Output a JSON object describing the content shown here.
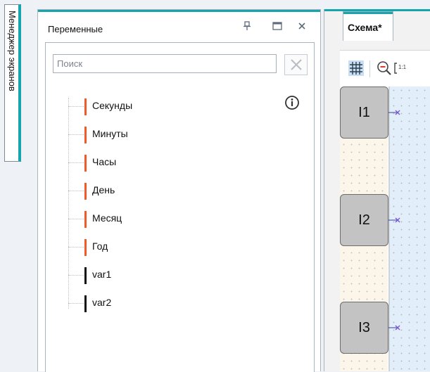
{
  "screen_manager": {
    "tab_label": "Менеджер экранов"
  },
  "variables_panel": {
    "title": "Переменные",
    "pin_icon": "pin-icon",
    "maximize_icon": "maximize-icon",
    "close_icon": "close-icon",
    "search": {
      "placeholder": "Поиск",
      "value": ""
    },
    "items": [
      {
        "label": "Секунды",
        "color": "#f05a28"
      },
      {
        "label": "Минуты",
        "color": "#f05a28"
      },
      {
        "label": "Часы",
        "color": "#f05a28"
      },
      {
        "label": "День",
        "color": "#f05a28"
      },
      {
        "label": "Месяц",
        "color": "#f05a28"
      },
      {
        "label": "Год",
        "color": "#f05a28"
      },
      {
        "label": "var1",
        "color": "#111111"
      },
      {
        "label": "var2",
        "color": "#111111"
      }
    ]
  },
  "schema_panel": {
    "tab_label": "Схема*",
    "toolbar": [
      "grid-icon",
      "zoom-out-icon",
      "zoom-reset-icon"
    ],
    "blocks": [
      {
        "label": "I1"
      },
      {
        "label": "I2"
      },
      {
        "label": "I3"
      }
    ]
  },
  "colors": {
    "accent": "#16a4ad",
    "system_var": "#f05a28",
    "user_var": "#111111"
  }
}
